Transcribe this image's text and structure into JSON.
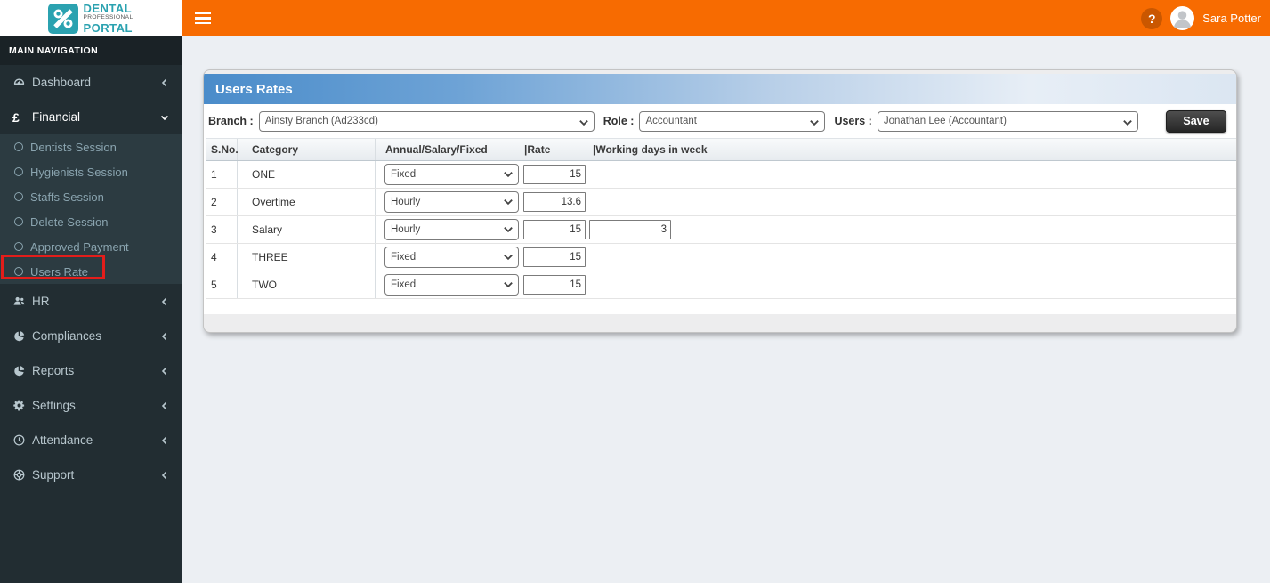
{
  "logo": {
    "mark": "%",
    "line1": "DENTAL",
    "line2": "PROFESSIONAL",
    "line3": "PORTAL"
  },
  "topbar": {
    "help_glyph": "?",
    "user_name": "Sara Potter"
  },
  "sidebar": {
    "section_label": "MAIN NAVIGATION",
    "items": [
      {
        "label": "Dashboard",
        "icon": "gauge-icon",
        "expanded": false
      },
      {
        "label": "Financial",
        "icon": "pound-icon",
        "expanded": true
      },
      {
        "label": "HR",
        "icon": "users-icon",
        "expanded": false
      },
      {
        "label": "Compliances",
        "icon": "pie-icon",
        "expanded": false
      },
      {
        "label": "Reports",
        "icon": "pie-icon",
        "expanded": false
      },
      {
        "label": "Settings",
        "icon": "gear-icon",
        "expanded": false
      },
      {
        "label": "Attendance",
        "icon": "clock-icon",
        "expanded": false
      },
      {
        "label": "Support",
        "icon": "life-ring-icon",
        "expanded": false
      }
    ],
    "financial_children": [
      "Dentists Session",
      "Hygienists Session",
      "Staffs Session",
      "Delete Session",
      "Approved Payment",
      "Users Rate"
    ],
    "highlighted_child": "Users Rate"
  },
  "panel": {
    "title": "Users Rates",
    "filters": {
      "branch_label": "Branch :",
      "branch_value": "Ainsty Branch (Ad233cd)",
      "role_label": "Role :",
      "role_value": "Accountant",
      "users_label": "Users :",
      "users_value": "Jonathan Lee (Accountant)",
      "save_label": "Save"
    },
    "table": {
      "headers": [
        "S.No.",
        "Category",
        "Annual/Salary/Fixed",
        "|Rate",
        "|Working days in week"
      ],
      "rows": [
        {
          "sno": "1",
          "category": "ONE",
          "type": "Fixed",
          "rate": "15"
        },
        {
          "sno": "2",
          "category": "Overtime",
          "type": "Hourly",
          "rate": "13.6"
        },
        {
          "sno": "3",
          "category": "Salary",
          "type": "Hourly",
          "rate": "15",
          "working_days": "3"
        },
        {
          "sno": "4",
          "category": "THREE",
          "type": "Fixed",
          "rate": "15"
        },
        {
          "sno": "5",
          "category": "TWO",
          "type": "Fixed",
          "rate": "15"
        }
      ]
    }
  },
  "colors": {
    "accent_orange": "#f76b01",
    "brand_teal": "#2ba2b0",
    "sidebar_bg": "#222d32",
    "submenu_bg": "#2c3b41",
    "nav_band_bg": "#1a2226",
    "panel_header_blue": "#4a8cca",
    "annotation_red": "#e31d1a",
    "save_button_dark": "#333333",
    "content_bg": "#eceff3"
  }
}
